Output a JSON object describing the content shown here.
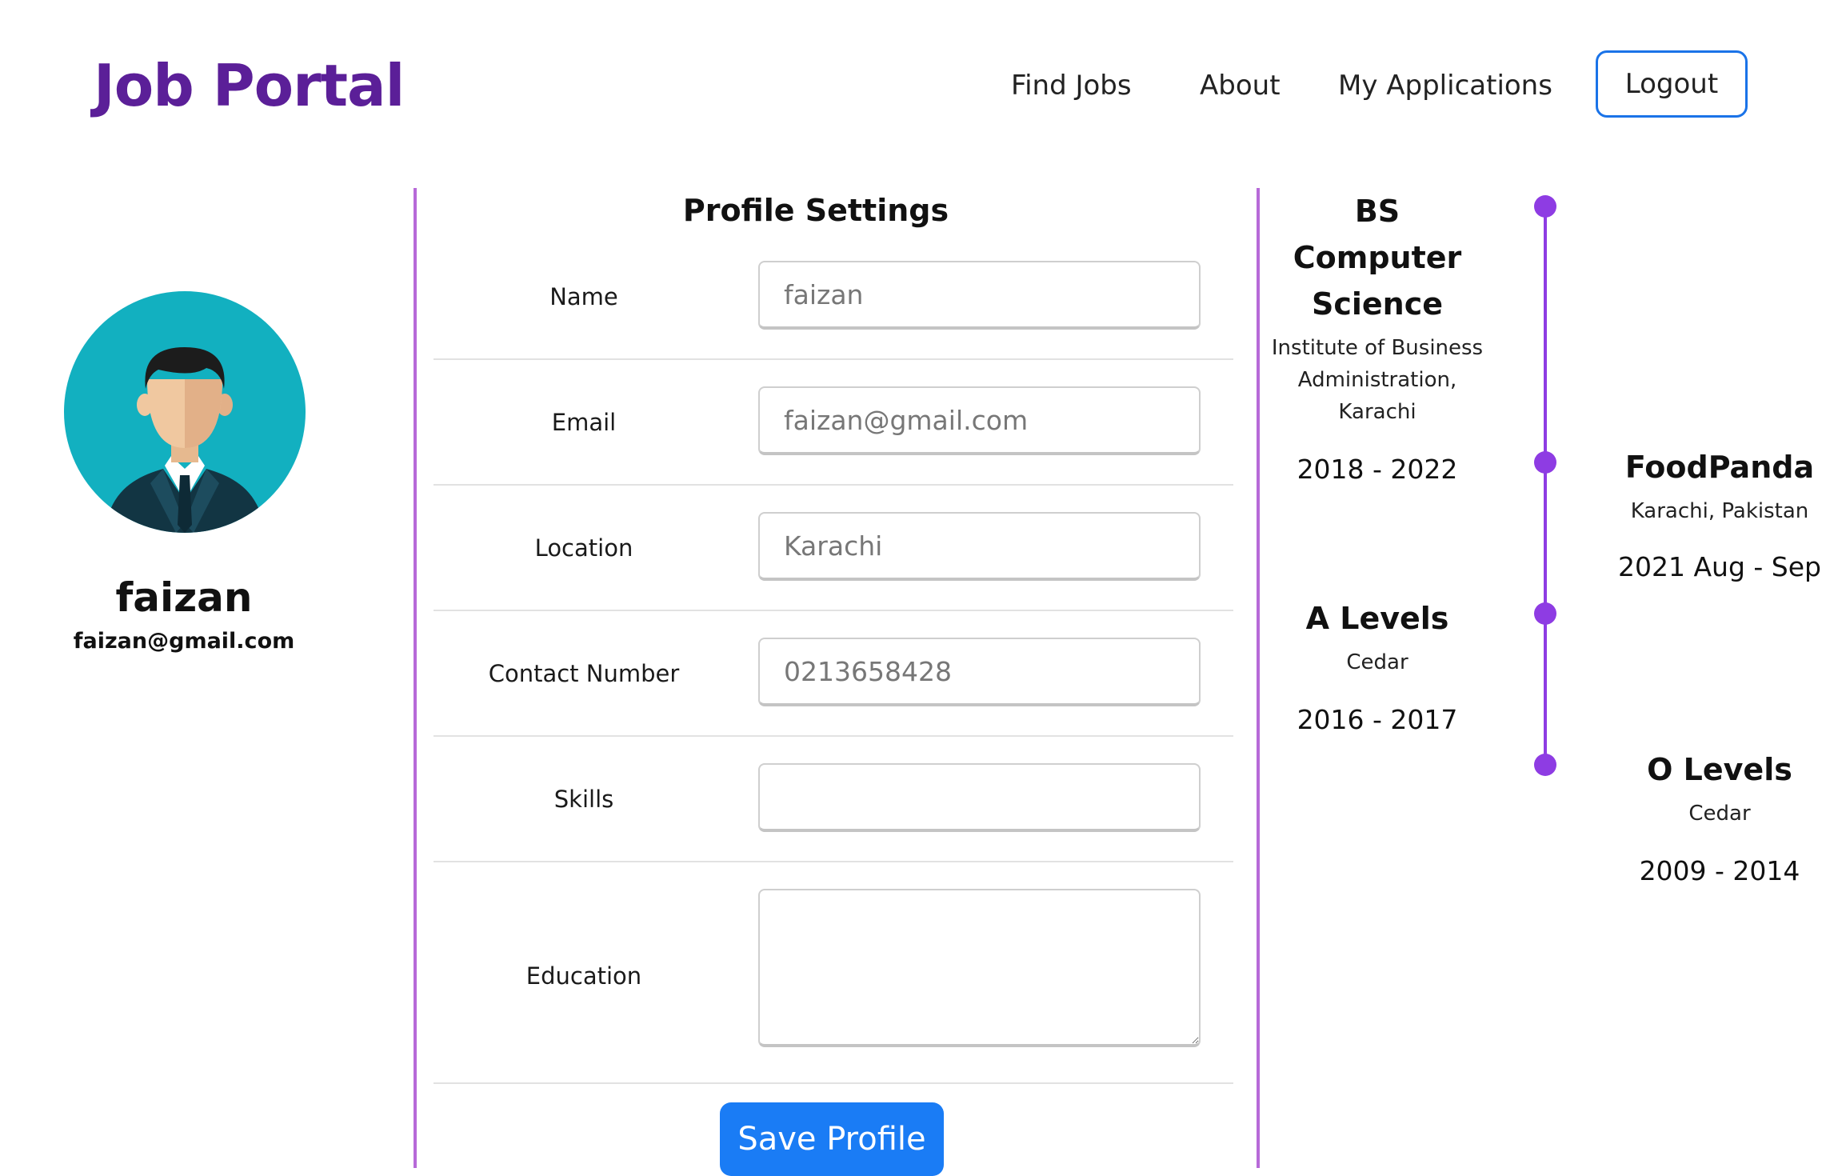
{
  "header": {
    "brand": "Job Portal",
    "nav": [
      {
        "label": "Find Jobs"
      },
      {
        "label": "About"
      },
      {
        "label": "My Applications"
      }
    ],
    "logout_label": "Logout"
  },
  "profile": {
    "name": "faizan",
    "email": "faizan@gmail.com",
    "avatar_icon": "user-avatar-icon"
  },
  "form": {
    "title": "Profile Settings",
    "fields": {
      "name": {
        "label": "Name",
        "value": "faizan"
      },
      "email": {
        "label": "Email",
        "value": "faizan@gmail.com"
      },
      "location": {
        "label": "Location",
        "value": "Karachi"
      },
      "contact": {
        "label": "Contact Number",
        "value": "0213658428"
      },
      "skills": {
        "label": "Skills",
        "value": ""
      },
      "education": {
        "label": "Education",
        "value": ""
      }
    },
    "save_label": "Save Profile"
  },
  "timeline": {
    "items": [
      {
        "title": "BS Computer Science",
        "subtitle": "Institute of Business Administration, Karachi",
        "date": "2018 - 2022"
      },
      {
        "title": "FoodPanda",
        "subtitle": "Karachi, Pakistan",
        "date": "2021 Aug - Sep"
      },
      {
        "title": "A Levels",
        "subtitle": "Cedar",
        "date": "2016 - 2017"
      },
      {
        "title": "O Levels",
        "subtitle": "Cedar",
        "date": "2009 - 2014"
      }
    ]
  },
  "colors": {
    "brand": "#5b1f98",
    "accent_blue": "#1a7cf5",
    "timeline": "#8e3ce3",
    "divider": "#b76ad8",
    "avatar_bg": "#12b0c0"
  }
}
